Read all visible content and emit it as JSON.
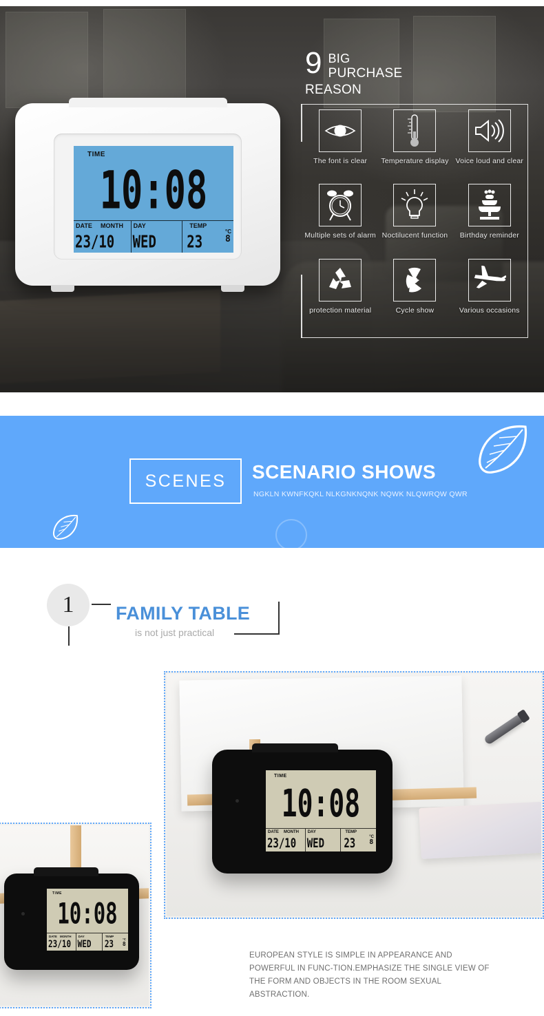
{
  "hero": {
    "headline": {
      "number": "9",
      "line1": "BIG",
      "line2": "PURCHASE REASON"
    },
    "features": [
      {
        "icon": "eye-icon",
        "label": "The font is clear"
      },
      {
        "icon": "thermometer-icon",
        "label": "Temperature display"
      },
      {
        "icon": "speaker-icon",
        "label": "Voice loud and clear"
      },
      {
        "icon": "alarm-clock-icon",
        "label": "Multiple sets of alarm"
      },
      {
        "icon": "lightbulb-icon",
        "label": "Noctilucent function"
      },
      {
        "icon": "birthday-cake-icon",
        "label": "Birthday reminder"
      },
      {
        "icon": "recycle-icon",
        "label": "protection material"
      },
      {
        "icon": "radiation-icon",
        "label": "Cycle show"
      },
      {
        "icon": "airplane-icon",
        "label": "Various occasions"
      }
    ],
    "clock": {
      "time_label": "TIME",
      "time_value": "10:08",
      "date_label": "DATE",
      "month_label": "MONTH",
      "date_value": "23/10",
      "day_label": "DAY",
      "day_value": "WED",
      "temp_label": "TEMP",
      "temp_value": "23",
      "temp_decimal": "8",
      "temp_unit_c": "°C",
      "backlight_color": "#64a9d8"
    }
  },
  "scenes_banner": {
    "box_label": "SCENES",
    "title": "SCENARIO SHOWS",
    "subtitle": "NGKLN KWNFKQKL NLKGNKNQNK NQWK NLQWRQW QWR",
    "background_color": "#5FA8FB",
    "leaf_icon_large": "leaf-icon",
    "leaf_icon_small": "leaf-icon"
  },
  "family_section": {
    "badge_number": "1",
    "title": "FAMILY TABLE",
    "subtitle": "is not just practical",
    "title_color": "#4a90d9",
    "description": "EUROPEAN STYLE IS SIMPLE IN APPEARANCE AND POWERFUL IN FUNC-TION.EMPHASIZE THE SINGLE VIEW OF THE FORM AND OBJECTS IN THE ROOM SEXUAL ABSTRACTION.",
    "photo_border_color": "#5FA8FB",
    "clock_main": {
      "time_label": "TIME",
      "time_value": "10:08",
      "date_label": "DATE",
      "month_label": "MONTH",
      "date_value": "23/10",
      "day_label": "DAY",
      "day_value": "WED",
      "temp_label": "TEMP",
      "temp_value": "23",
      "temp_decimal": "8",
      "temp_unit_c": "°C",
      "body_color": "#0d0d0d",
      "lcd_color": "#cfcbb4"
    },
    "clock_inset": {
      "time_label": "TIME",
      "time_value": "10:08",
      "date_label": "DATE",
      "month_label": "MONTH",
      "date_value": "23/10",
      "day_label": "DAY",
      "day_value": "WED",
      "temp_label": "TEMP",
      "temp_value": "23",
      "temp_decimal": "8",
      "temp_unit_c": "°C"
    }
  }
}
